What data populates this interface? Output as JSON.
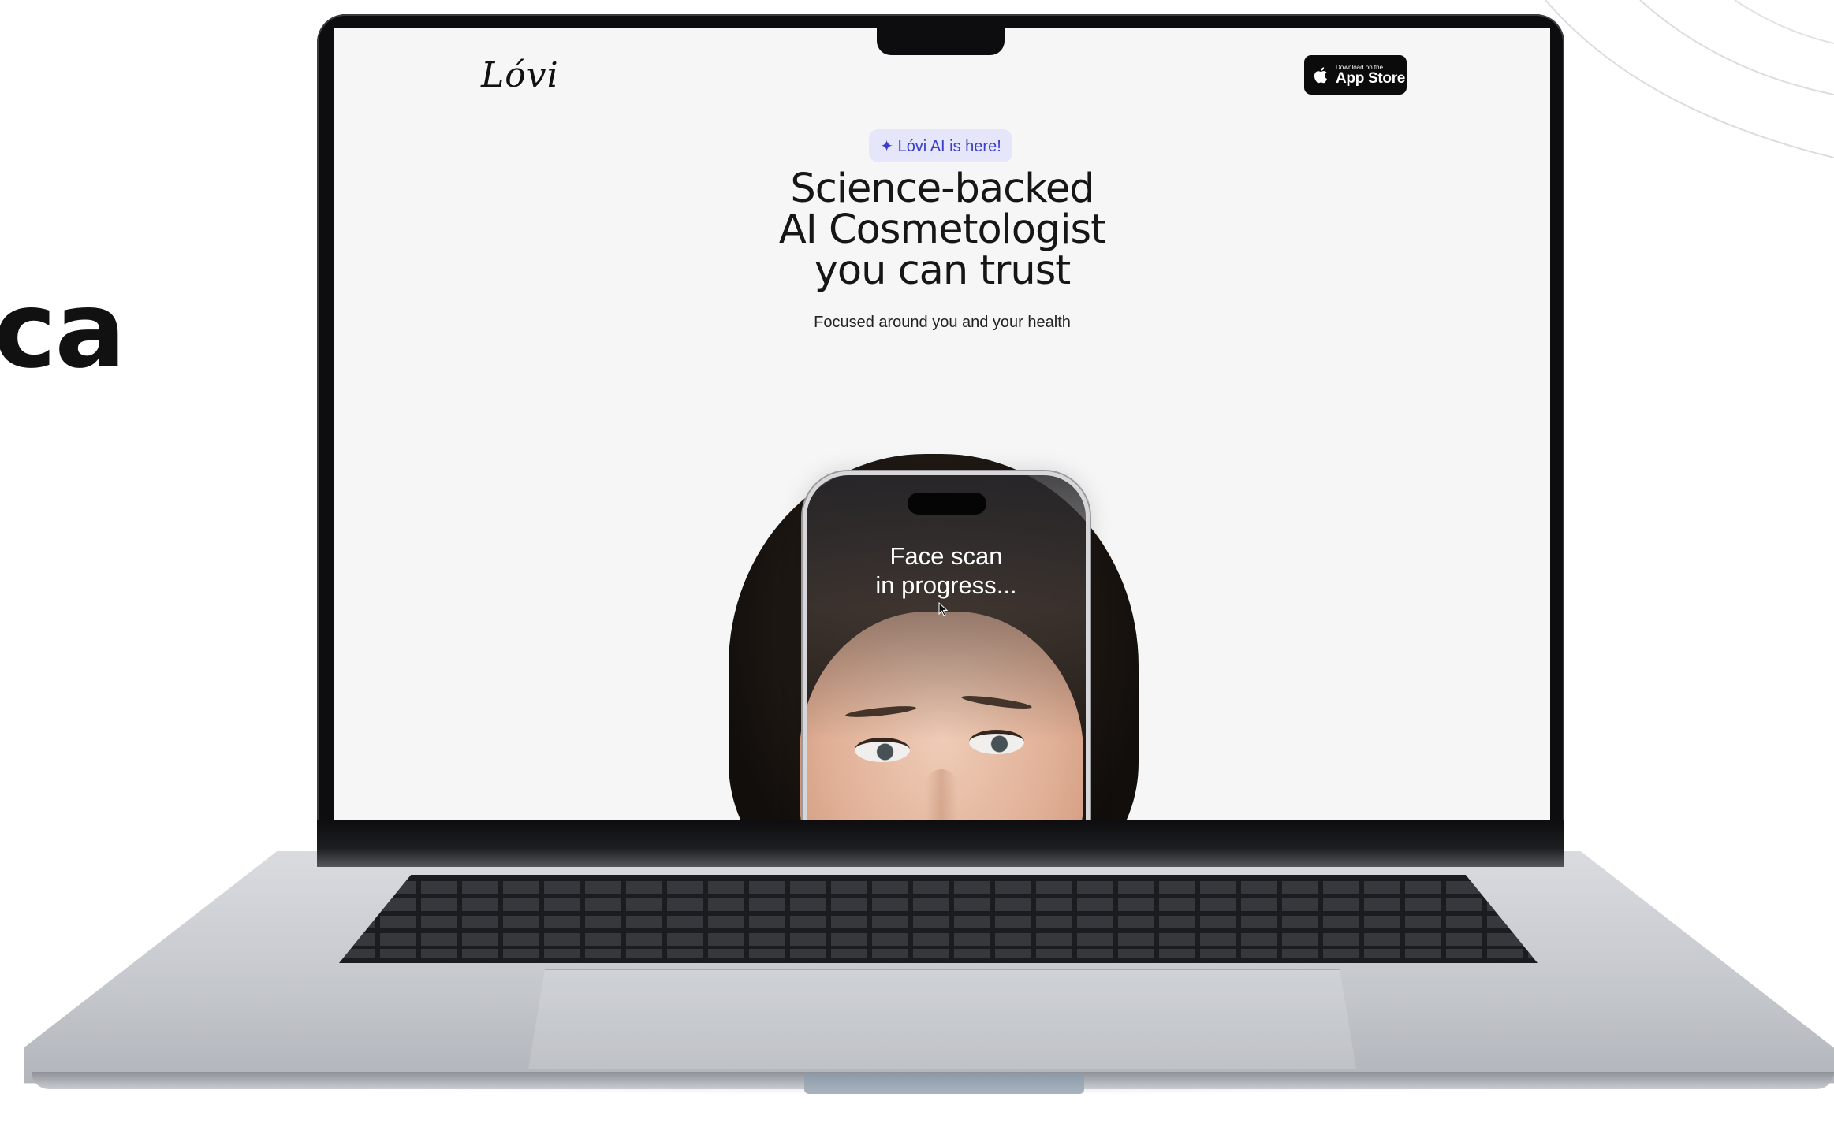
{
  "background_text": "ca",
  "laptop": {
    "screen": {
      "logo": "Lóvi",
      "app_store": {
        "small_label": "Download on the",
        "big_label": "App Store"
      },
      "badge": "✦ Lóvi AI is here!",
      "headline": [
        "Science-backed",
        "AI Cosmetologist",
        "you can trust"
      ],
      "subheadline": "Focused around you and your health",
      "phone_overlay": [
        "Face scan",
        "in progress..."
      ]
    }
  },
  "colors": {
    "badge_bg": "#e6e6fa",
    "badge_text": "#3a3ec8",
    "screen_bg": "#f6f6f6",
    "app_store_bg": "#0b0b0b"
  }
}
